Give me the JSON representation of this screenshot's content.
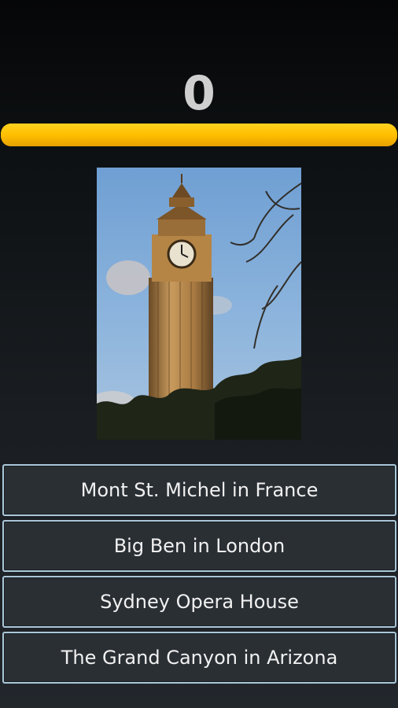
{
  "score": "0",
  "progress": {
    "fraction": 1.0,
    "color": "#ffbf00"
  },
  "image": {
    "subject": "big-ben-photo"
  },
  "answers": [
    {
      "label": "Mont St. Michel in France"
    },
    {
      "label": "Big Ben in London"
    },
    {
      "label": "Sydney Opera House"
    },
    {
      "label": "The Grand Canyon in Arizona"
    }
  ],
  "colors": {
    "accent": "#ffbf00",
    "answer_border": "#a9c7d8",
    "answer_bg": "#2a2f34"
  }
}
